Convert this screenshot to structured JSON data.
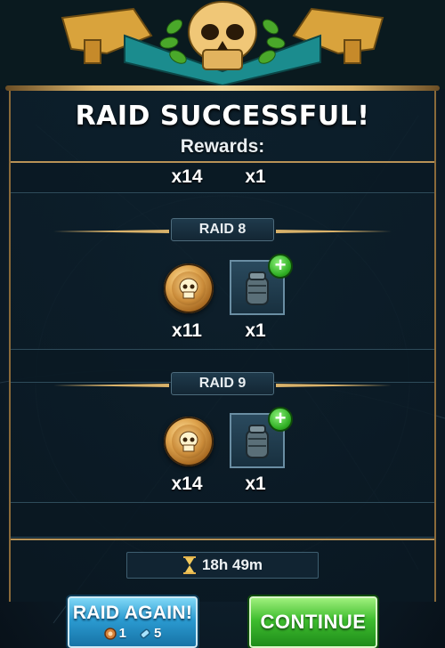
{
  "dialog": {
    "title": "RAID SUCCESSFUL!",
    "subtitle": "Rewards:"
  },
  "total_rewards": {
    "coins_qty": "x14",
    "item_qty": "x1"
  },
  "raids": [
    {
      "label": "RAID 8",
      "coins_qty": "x11",
      "item_qty": "x1",
      "coin_icon": "skull-coin-icon",
      "item_icon": "battery-pack-icon"
    },
    {
      "label": "RAID 9",
      "coins_qty": "x14",
      "item_qty": "x1",
      "coin_icon": "skull-coin-icon",
      "item_icon": "battery-pack-icon"
    }
  ],
  "timer": {
    "icon": "hourglass-icon",
    "value": "18h 49m"
  },
  "buttons": {
    "raid_again": {
      "label": "RAID AGAIN!",
      "cost_a": "1",
      "cost_a_icon": "raid-ticket-icon",
      "cost_b": "5",
      "cost_b_icon": "energy-cell-icon"
    },
    "continue": {
      "label": "CONTINUE"
    }
  },
  "colors": {
    "accent_gold": "#d9b26a",
    "raid_again_blue": "#2b9bd1",
    "continue_green": "#3fbe2f",
    "plus_green": "#2fae23"
  }
}
